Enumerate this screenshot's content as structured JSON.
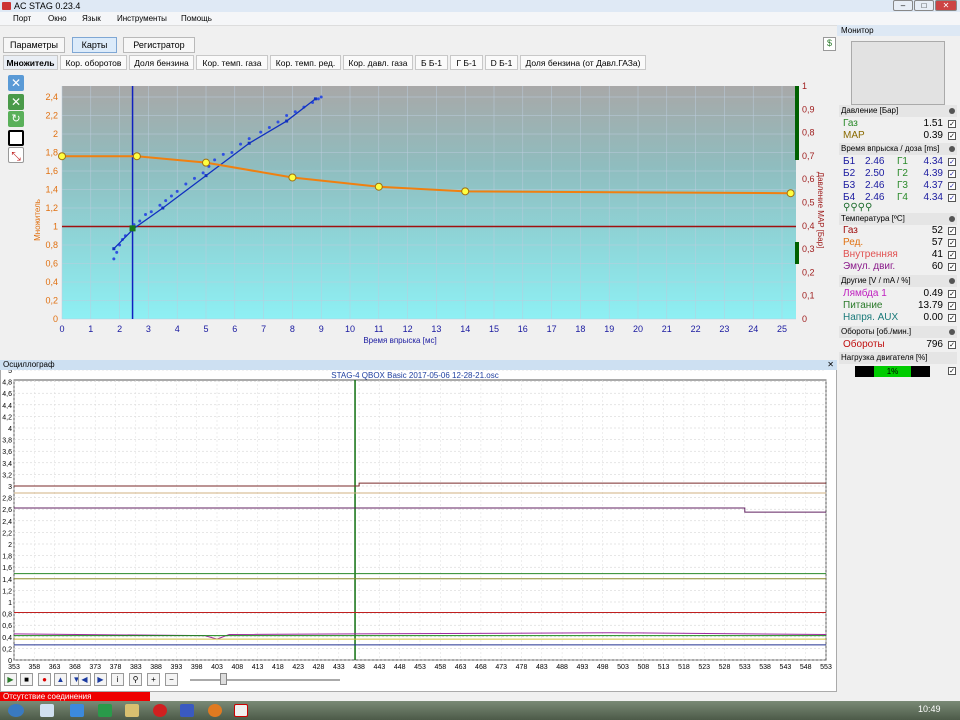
{
  "window": {
    "title": "AC STAG 0.23.4"
  },
  "menu": [
    "Порт",
    "Окно",
    "Язык",
    "Инструменты",
    "Помощь"
  ],
  "tabs": [
    "Параметры",
    "Карты",
    "Регистратор"
  ],
  "subtabs": [
    "Множитель",
    "Кор. оборотов",
    "Доля бензина",
    "Кор. темп. газа",
    "Кор. темп. ред.",
    "Кор. давл. газа",
    "Б Б-1",
    "Г Б-1",
    "D Б-1",
    "Доля бензина (от Давл.ГАЗа)"
  ],
  "map_chart": {
    "xlabel": "Время впрыска [мс]",
    "ylabel_left": "Множитель",
    "ylabel_right": "Давление MAP [Бар]",
    "x_ticks": [
      "0",
      "1",
      "2",
      "3",
      "4",
      "5",
      "6",
      "7",
      "8",
      "9",
      "10",
      "11",
      "12",
      "13",
      "14",
      "15",
      "16",
      "17",
      "18",
      "19",
      "20",
      "21",
      "22",
      "23",
      "24",
      "25"
    ],
    "y_ticks_left": [
      "0",
      "0,2",
      "0,4",
      "0,6",
      "0,8",
      "1",
      "1,2",
      "1,4",
      "1,6",
      "1,8",
      "2",
      "2,2",
      "2,4"
    ],
    "y_ticks_right": [
      "0",
      "0,1",
      "0,2",
      "0,3",
      "0,4",
      "0,5",
      "0,6",
      "0,7",
      "0,8",
      "0,9",
      "1"
    ],
    "multiplier_curve": [
      [
        0,
        1.76
      ],
      [
        2.6,
        1.76
      ],
      [
        5,
        1.69
      ],
      [
        8,
        1.53
      ],
      [
        11,
        1.43
      ],
      [
        14,
        1.38
      ],
      [
        25.3,
        1.36
      ]
    ],
    "blue_line": [
      [
        1.8,
        0.76
      ],
      [
        2.5,
        0.98
      ],
      [
        3.5,
        1.2
      ],
      [
        5,
        1.55
      ],
      [
        6.5,
        1.9
      ],
      [
        7.8,
        2.14
      ],
      [
        8.8,
        2.38
      ]
    ],
    "samples": [
      [
        1.8,
        0.65
      ],
      [
        1.9,
        0.72
      ],
      [
        2.0,
        0.8
      ],
      [
        2.1,
        0.86
      ],
      [
        2.2,
        0.9
      ],
      [
        2.4,
        0.97
      ],
      [
        2.5,
        1.02
      ],
      [
        2.7,
        1.06
      ],
      [
        2.9,
        1.13
      ],
      [
        3.1,
        1.16
      ],
      [
        3.4,
        1.23
      ],
      [
        3.6,
        1.28
      ],
      [
        3.8,
        1.33
      ],
      [
        4.0,
        1.38
      ],
      [
        4.3,
        1.46
      ],
      [
        4.6,
        1.52
      ],
      [
        4.9,
        1.58
      ],
      [
        5.1,
        1.65
      ],
      [
        5.3,
        1.72
      ],
      [
        5.6,
        1.78
      ],
      [
        5.9,
        1.8
      ],
      [
        6.2,
        1.89
      ],
      [
        6.5,
        1.95
      ],
      [
        6.9,
        2.02
      ],
      [
        7.2,
        2.07
      ],
      [
        7.5,
        2.13
      ],
      [
        7.8,
        2.2
      ],
      [
        8.1,
        2.24
      ],
      [
        8.4,
        2.29
      ],
      [
        8.7,
        2.34
      ],
      [
        8.9,
        2.38
      ],
      [
        9.0,
        2.4
      ]
    ],
    "cursor_x": 2.45,
    "ref_y": 1.0,
    "map_point": [
      2.45,
      0.98
    ]
  },
  "monitor": {
    "title": "Монитор",
    "pressure": {
      "head": "Давление [Бар]",
      "rows": [
        {
          "label": "Газ",
          "value": "1.51",
          "color": "#2a8a2a"
        },
        {
          "label": "MAP",
          "value": "0.39",
          "color": "#8a6a00"
        }
      ]
    },
    "injection": {
      "head": "Время впрыска / доза [ms]",
      "rows": [
        {
          "b": "Б1",
          "bv": "2.46",
          "g": "Г1",
          "gv": "4.34"
        },
        {
          "b": "Б2",
          "bv": "2.50",
          "g": "Г2",
          "gv": "4.39"
        },
        {
          "b": "Б3",
          "bv": "2.46",
          "g": "Г3",
          "gv": "4.37"
        },
        {
          "b": "Б4",
          "bv": "2.46",
          "g": "Г4",
          "gv": "4.34"
        }
      ]
    },
    "temperature": {
      "head": "Температура [ºC]",
      "rows": [
        {
          "label": "Газ",
          "value": "52",
          "color": "#a01010"
        },
        {
          "label": "Ред.",
          "value": "57",
          "color": "#e07010"
        },
        {
          "label": "Внутренняя",
          "value": "41",
          "color": "#e05050"
        },
        {
          "label": "Эмул. двиг.",
          "value": "60",
          "color": "#8a1a8a"
        }
      ]
    },
    "other": {
      "head": "Другие [V / mA / %]",
      "rows": [
        {
          "label": "Лямбда 1",
          "value": "0.49",
          "color": "#c020c0"
        },
        {
          "label": "Питание",
          "value": "13.79",
          "color": "#2a7a2a"
        },
        {
          "label": "Напря. AUX",
          "value": "0.00",
          "color": "#1a7a7a"
        }
      ]
    },
    "rpm": {
      "head": "Обороты [об./мин.]",
      "label": "Обороты",
      "value": "796",
      "color": "#c01010"
    },
    "load": {
      "head": "Нагрузка двигателя [%]",
      "value": "1%"
    }
  },
  "osc": {
    "title": "Осциллограф",
    "file": "STAG-4 QBOX Basic 2017-05-06 12-28-21.osc",
    "y_ticks": [
      "0",
      "0,2",
      "0,4",
      "0,6",
      "0,8",
      "1",
      "1,2",
      "1,4",
      "1,6",
      "1,8",
      "2",
      "2,2",
      "2,4",
      "2,6",
      "2,8",
      "3",
      "3,2",
      "3,4",
      "3,6",
      "3,8",
      "4",
      "4,2",
      "4,4",
      "4,6",
      "4,8",
      "5"
    ],
    "x_ticks": [
      "353",
      "358",
      "363",
      "368",
      "373",
      "378",
      "383",
      "388",
      "393",
      "398",
      "403",
      "408",
      "413",
      "418",
      "423",
      "428",
      "433",
      "438",
      "443",
      "448",
      "453",
      "458",
      "463",
      "468",
      "473",
      "478",
      "483",
      "488",
      "493",
      "498",
      "503",
      "508",
      "513",
      "518",
      "523",
      "528",
      "533",
      "538",
      "543",
      "548",
      "553"
    ],
    "cursor": 437
  },
  "status": "Отсутствие соединения",
  "clock": "10:49"
}
